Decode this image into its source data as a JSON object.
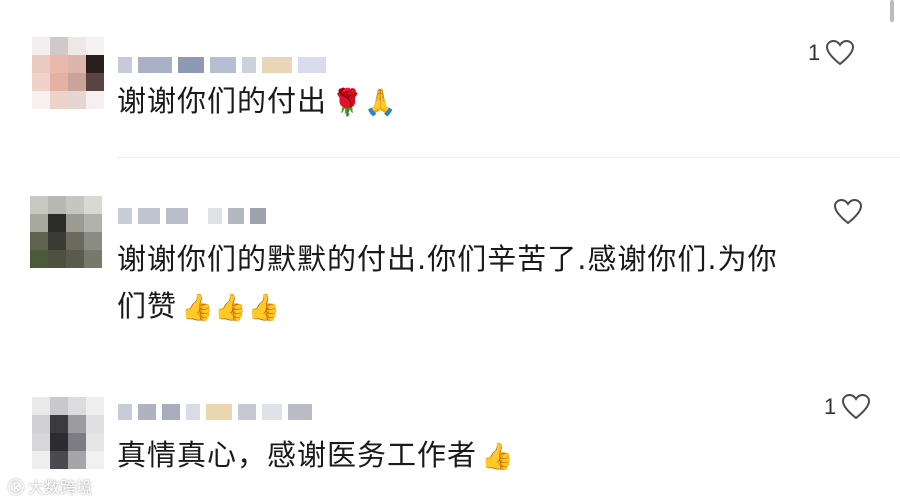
{
  "comments": [
    {
      "text": "谢谢你们的付出",
      "emoji": "🌹🙏",
      "like_count": "1"
    },
    {
      "text_line1": "谢谢你们的默默的付出.你们辛苦了.感谢你们.为你",
      "text_line2": "们赞",
      "emoji": "👍👍👍",
      "like_count": ""
    },
    {
      "text": "真情真心，感谢医务工作者",
      "emoji": "👍",
      "like_count": "1"
    }
  ],
  "watermark": {
    "logo": "ⓚ",
    "text": "大数跨境"
  },
  "icons": {
    "like": "heart-outline-icon",
    "avatar": "pixelated-avatar"
  },
  "colors": {
    "text": "#1a1a1a",
    "divider": "#ececec",
    "icon": "#444444"
  }
}
